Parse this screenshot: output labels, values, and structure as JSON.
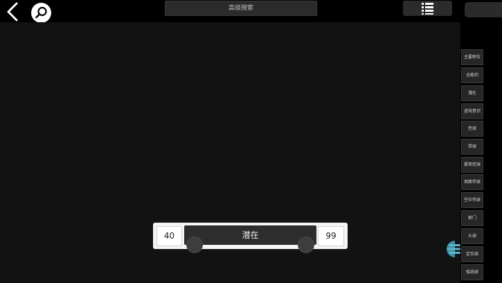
{
  "header": {
    "back_icon": "chevron-left-icon",
    "search_icon": "magnifier-icon",
    "advanced_search_label": "高级搜索",
    "list_icon": "list-icon"
  },
  "filters": {
    "items": [
      {
        "label": "主要职位"
      },
      {
        "label": "全能的"
      },
      {
        "label": "潜在"
      },
      {
        "label": "进攻意识"
      },
      {
        "label": "控球"
      },
      {
        "label": "带球"
      },
      {
        "label": "紧密控球"
      },
      {
        "label": "地面传球"
      },
      {
        "label": "空中传球"
      },
      {
        "label": "射门"
      },
      {
        "label": "头球"
      },
      {
        "label": "定位球"
      },
      {
        "label": "弧线球"
      }
    ]
  },
  "side_menu": {
    "icon": "menu-lines-icon"
  },
  "range": {
    "label": "潜在",
    "min_value": "40",
    "max_value": "99",
    "low": 40,
    "high": 99
  },
  "colors": {
    "accent": "#5ab4c8"
  }
}
